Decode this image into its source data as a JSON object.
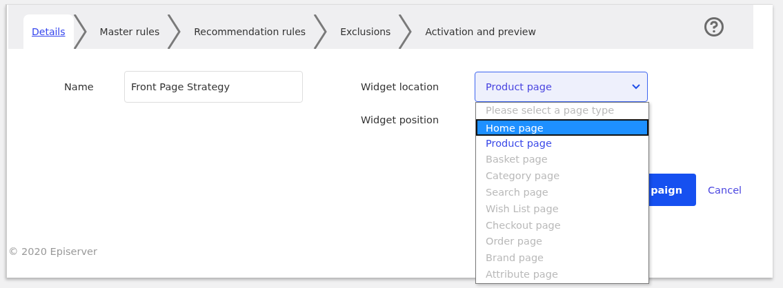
{
  "steps": [
    {
      "label": "Details",
      "selected": true
    },
    {
      "label": "Master rules",
      "selected": false
    },
    {
      "label": "Recommendation rules",
      "selected": false
    },
    {
      "label": "Exclusions",
      "selected": false
    },
    {
      "label": "Activation and preview",
      "selected": false
    }
  ],
  "form": {
    "name_label": "Name",
    "name_value": "Front Page Strategy",
    "location_label": "Widget location",
    "location_value": "Product page",
    "position_label": "Widget position"
  },
  "dropdown": [
    {
      "label": "Please select a page type",
      "disabled": true,
      "highlighted": false,
      "selected": false
    },
    {
      "label": "Home page",
      "disabled": false,
      "highlighted": true,
      "selected": false
    },
    {
      "label": "Product page",
      "disabled": false,
      "highlighted": false,
      "selected": true
    },
    {
      "label": "Basket page",
      "disabled": true,
      "highlighted": false,
      "selected": false
    },
    {
      "label": "Category page",
      "disabled": true,
      "highlighted": false,
      "selected": false
    },
    {
      "label": "Search page",
      "disabled": true,
      "highlighted": false,
      "selected": false
    },
    {
      "label": "Wish List page",
      "disabled": true,
      "highlighted": false,
      "selected": false
    },
    {
      "label": "Checkout page",
      "disabled": true,
      "highlighted": false,
      "selected": false
    },
    {
      "label": "Order page",
      "disabled": true,
      "highlighted": false,
      "selected": false
    },
    {
      "label": "Brand page",
      "disabled": true,
      "highlighted": false,
      "selected": false
    },
    {
      "label": "Attribute page",
      "disabled": true,
      "highlighted": false,
      "selected": false
    }
  ],
  "actions": {
    "primary": "paign",
    "cancel": "Cancel"
  },
  "footer": "© 2020 Episerver"
}
